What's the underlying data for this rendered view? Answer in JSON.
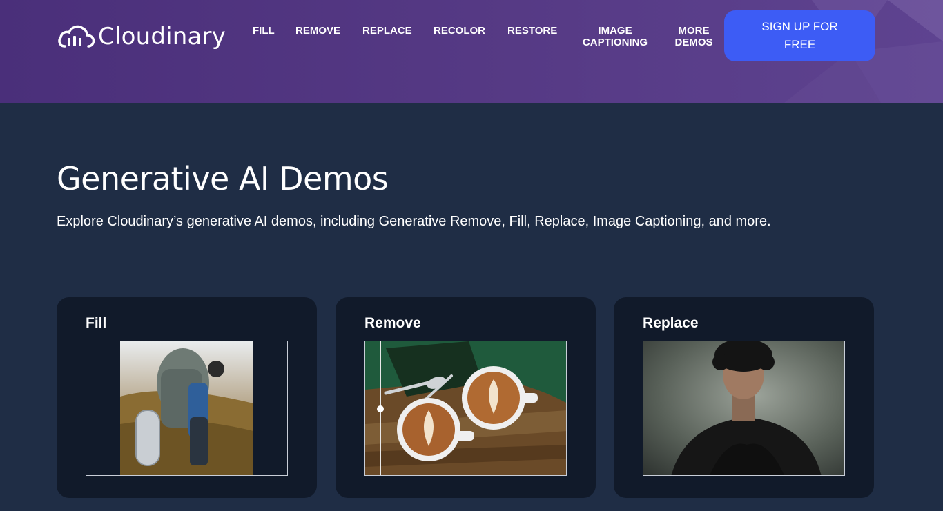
{
  "header": {
    "logo_text": "Cloudinary",
    "nav": [
      {
        "label": "FILL"
      },
      {
        "label": "REMOVE"
      },
      {
        "label": "REPLACE"
      },
      {
        "label": "RECOLOR"
      },
      {
        "label": "RESTORE"
      },
      {
        "label": "IMAGE CAPTIONING"
      },
      {
        "label": "MORE DEMOS"
      }
    ],
    "cta_label": "SIGN UP FOR FREE"
  },
  "main": {
    "title": "Generative AI Demos",
    "subtitle": "Explore Cloudinary’s generative AI demos, including Generative Remove, Fill, Replace, Image Captioning, and more."
  },
  "cards": [
    {
      "title": "Fill"
    },
    {
      "title": "Remove"
    },
    {
      "title": "Replace"
    }
  ],
  "colors": {
    "header_bg": "#4f3480",
    "page_bg": "#1f2d45",
    "card_bg": "#111a2a",
    "cta_bg": "#3d5cf5"
  }
}
